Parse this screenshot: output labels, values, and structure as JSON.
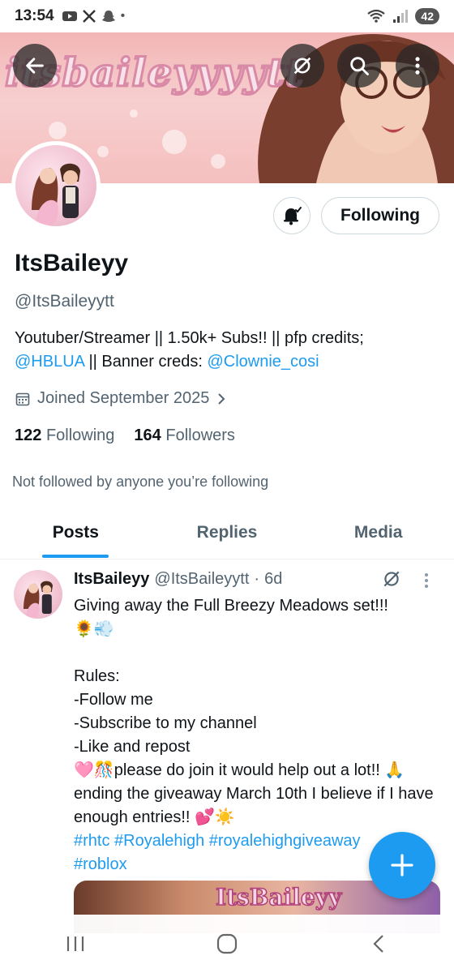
{
  "status_bar": {
    "time": "13:54",
    "dot": "•",
    "battery": "42"
  },
  "profile": {
    "banner_text": "itsbaileyyyytt",
    "display_name": "ItsBaileyy",
    "handle": "@ItsBaileyytt",
    "bio_text_1": "Youtuber/Streamer || 1.50k+ Subs!! || pfp credits;",
    "bio_link_1": "@HBLUA",
    "bio_text_2": " || Banner creds: ",
    "bio_link_2": "@Clownie_cosi",
    "joined": "Joined September 2025",
    "following_count": "122",
    "following_label": "Following",
    "followers_count": "164",
    "followers_label": "Followers",
    "not_followed": "Not followed by anyone you’re following",
    "following_button": "Following"
  },
  "tabs": [
    {
      "label": "Posts",
      "active": true
    },
    {
      "label": "Replies",
      "active": false
    },
    {
      "label": "Media",
      "active": false
    }
  ],
  "post": {
    "name": "ItsBaileyy",
    "handle": "@ItsBaileyytt",
    "sep": "·",
    "age": "6d",
    "line1": "Giving away the Full Breezy Meadows set!!!",
    "line2": "🌻💨",
    "rules_title": "Rules:",
    "rule1": "-Follow me",
    "rule2": "-Subscribe to my channel",
    "rule3": "-Like and repost",
    "line_help": "🩷🎊please do join it would help out a lot!! 🙏",
    "line_end": "ending the giveaway March 10th I believe if I have enough entries!! 💕☀️",
    "hashtags_1": "#rhtc #Royalehigh #royalehighgiveaway",
    "hashtags_2": "#roblox",
    "media_text": "ItsBaileyy"
  },
  "icons": {
    "back": "arrow-left-icon",
    "grok": "grok-icon",
    "search": "search-icon",
    "more": "more-vertical-icon",
    "bell": "bell-icon",
    "calendar": "calendar-icon",
    "compose": "plus-icon"
  },
  "colors": {
    "accent": "#1d9bf0",
    "text": "#0f1419",
    "secondary": "#536471"
  }
}
